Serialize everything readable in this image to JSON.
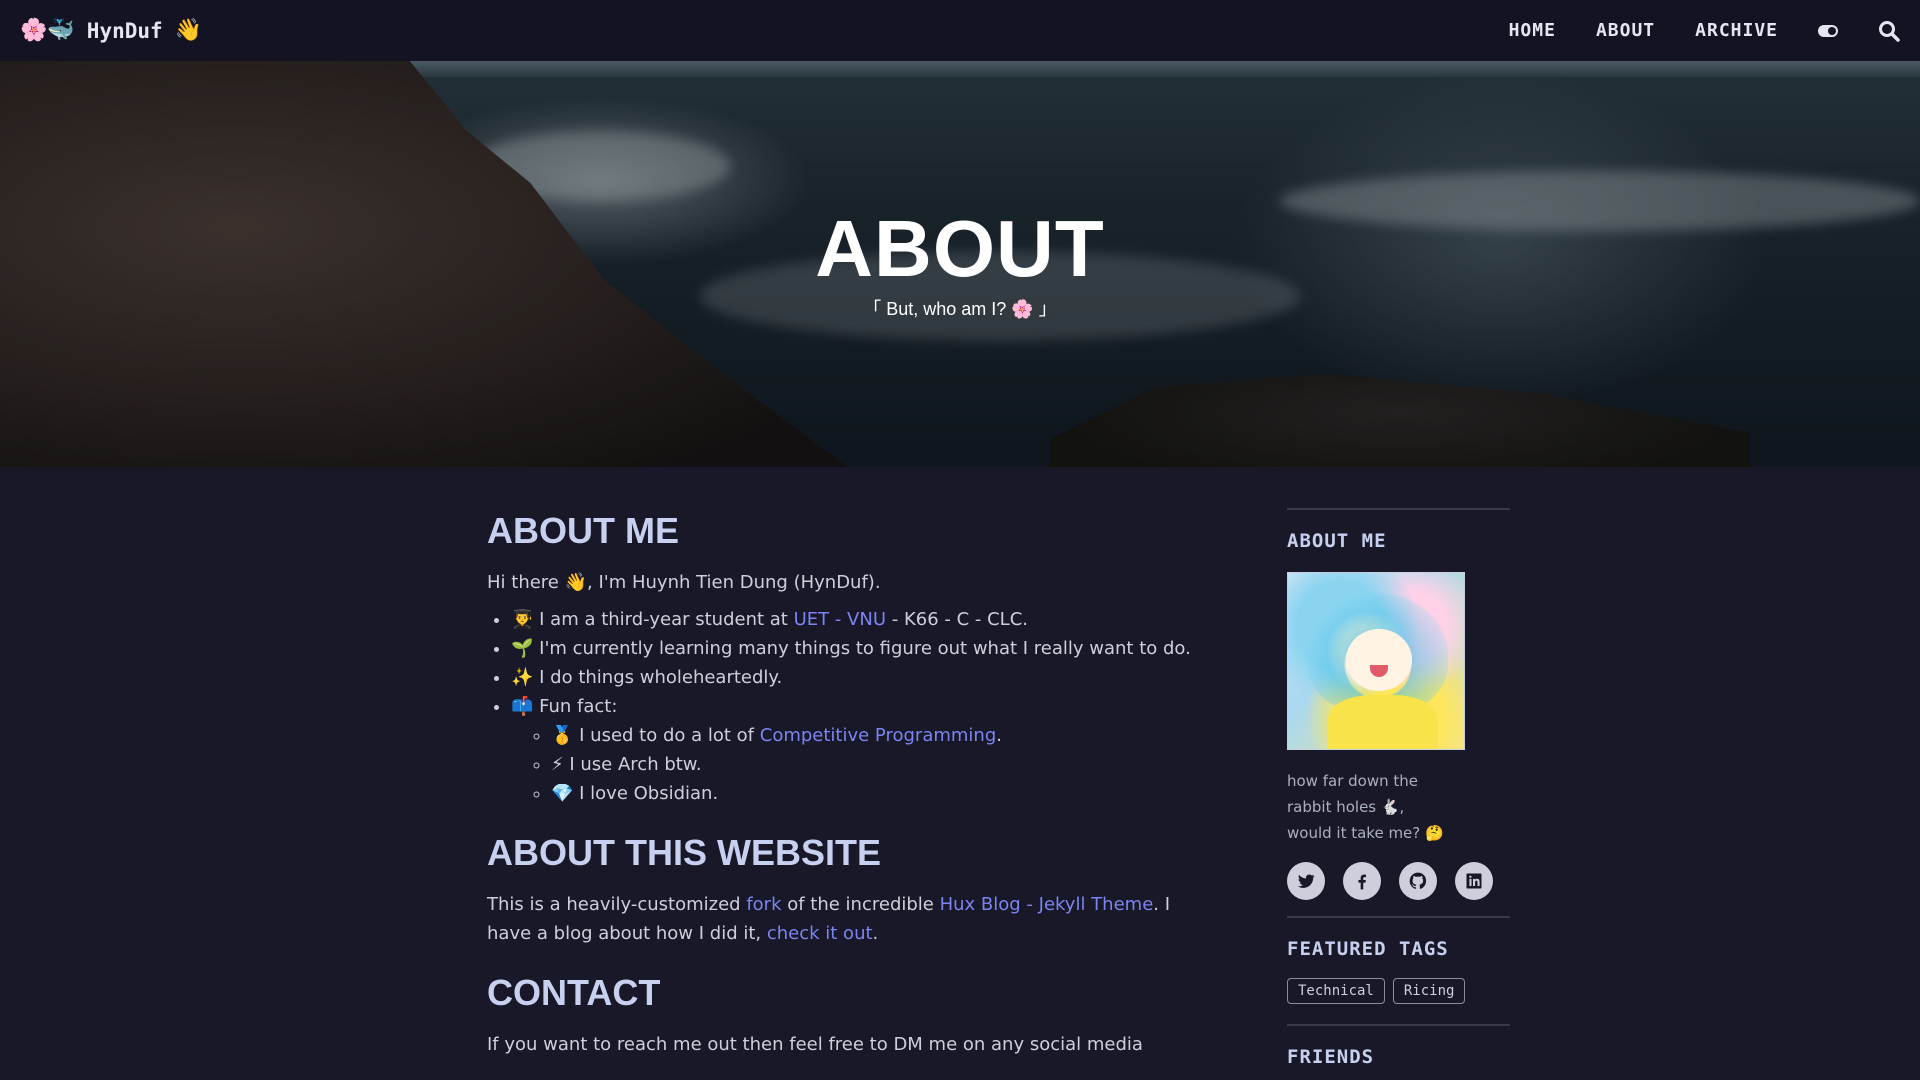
{
  "navbar": {
    "brand_emoji_left": "🌸🐳",
    "brand_name": "HynDuf",
    "brand_emoji_right": "👋",
    "links": [
      "HOME",
      "ABOUT",
      "ARCHIVE"
    ]
  },
  "hero": {
    "title": "ABOUT",
    "subtitle": "「 But, who am I? 🌸 」"
  },
  "about_me": {
    "title": "ABOUT ME",
    "intro": "Hi there 👋, I'm Huynh Tien Dung (HynDuf).",
    "items": {
      "student_pre": "👨‍🎓 I am a third-year student at ",
      "student_link": "UET - VNU",
      "student_post": " - K66 - C - CLC.",
      "learning": "🌱 I'm currently learning many things to figure out what I really want to do.",
      "wholehearted": "✨ I do things wholeheartedly.",
      "funfact": "📫 Fun fact:",
      "cp_pre": "🥇 I used to do a lot of ",
      "cp_link": "Competitive Programming",
      "cp_post": ".",
      "arch": "⚡ I use Arch btw.",
      "obsidian": "💎 I love Obsidian."
    }
  },
  "about_site": {
    "title": "ABOUT THIS WEBSITE",
    "p1": "This is a heavily-customized ",
    "fork_link": "fork",
    "p2": " of the incredible ",
    "hux_link": "Hux Blog - Jekyll Theme",
    "p3": ". I have a blog about how I did it, ",
    "check_link": "check it out",
    "p4": "."
  },
  "contact": {
    "title": "CONTACT",
    "text": "If you want to reach me out then feel free to DM me on any social media"
  },
  "sidebar": {
    "about_title": "ABOUT ME",
    "desc_line1": "how far down the",
    "desc_line2": "rabbit holes 🐇,",
    "desc_line3": "would it take me? 🤔",
    "socials": [
      "twitter-icon",
      "facebook-icon",
      "github-icon",
      "linkedin-icon"
    ],
    "featured_title": "FEATURED TAGS",
    "tags": [
      "Technical",
      "Ricing"
    ],
    "friends_title": "FRIENDS"
  },
  "colors": {
    "background": "#181828",
    "navbar": "#131323",
    "link": "#7b84f0",
    "heading": "#c8d0f0"
  }
}
